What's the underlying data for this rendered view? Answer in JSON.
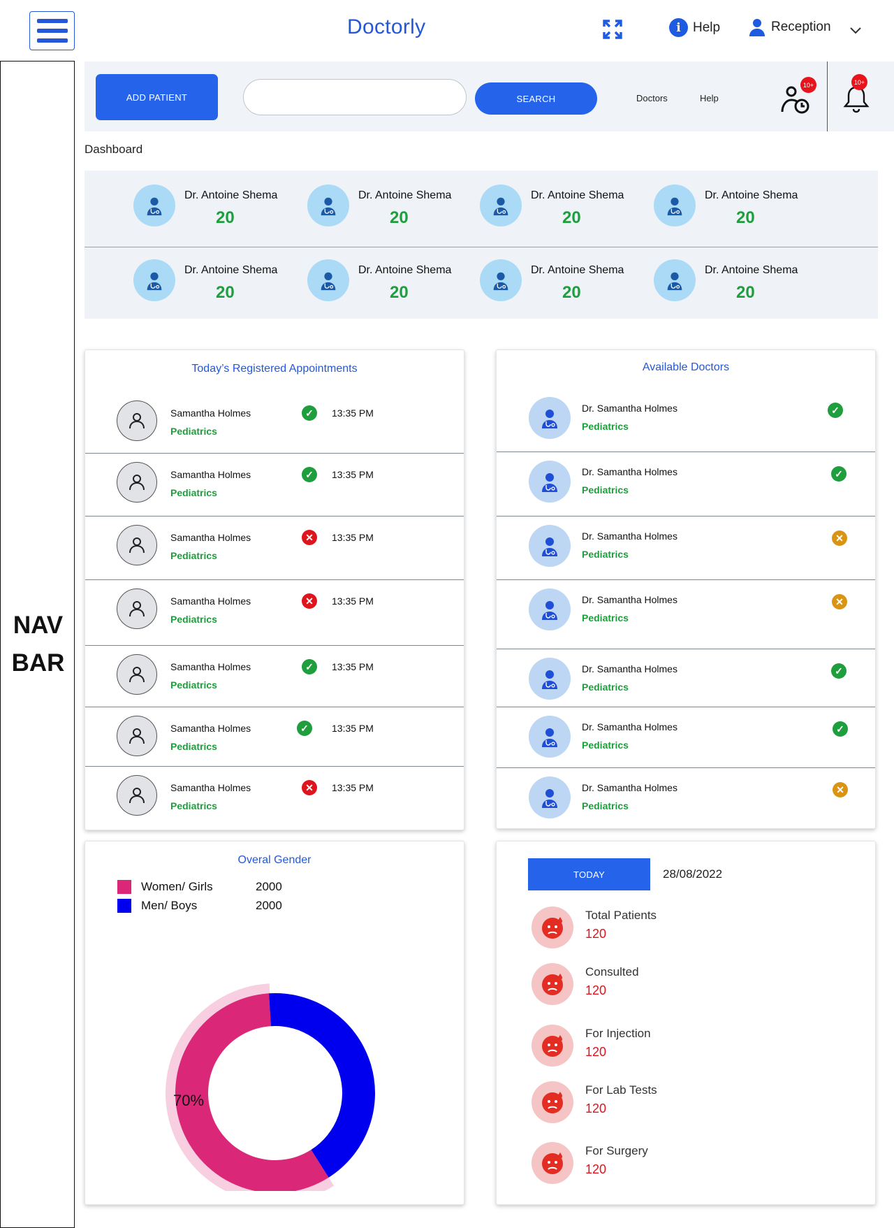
{
  "header": {
    "brand": "Doctorly",
    "help_label": "Help",
    "user_label": "Reception"
  },
  "navbar": {
    "label_line1": "NAV",
    "label_line2": "BAR"
  },
  "toolbar": {
    "add_patient_label": "ADD PATIENT",
    "search_placeholder": "",
    "search_button_label": "SEARCH",
    "links": [
      "Doctors",
      "Help"
    ],
    "appointments_badge": "10+",
    "notifications_badge": "10+"
  },
  "dashboard_title": "Dashboard",
  "doctor_stats": [
    {
      "name": "Dr. Antoine Shema",
      "count": "20"
    },
    {
      "name": "Dr. Antoine Shema",
      "count": "20"
    },
    {
      "name": "Dr. Antoine Shema",
      "count": "20"
    },
    {
      "name": "Dr. Antoine Shema",
      "count": "20"
    },
    {
      "name": "Dr. Antoine Shema",
      "count": "20"
    },
    {
      "name": "Dr. Antoine Shema",
      "count": "20"
    },
    {
      "name": "Dr. Antoine Shema",
      "count": "20"
    },
    {
      "name": "Dr. Antoine Shema",
      "count": "20"
    }
  ],
  "appointments": {
    "title": "Today’s Registered Appointments",
    "rows": [
      {
        "name": "Samantha Holmes",
        "dept": "Pediatrics",
        "status": "confirmed",
        "time": "13:35 PM"
      },
      {
        "name": "Samantha Holmes",
        "dept": "Pediatrics",
        "status": "confirmed",
        "time": "13:35 PM"
      },
      {
        "name": "Samantha Holmes",
        "dept": "Pediatrics",
        "status": "cancelled",
        "time": "13:35 PM"
      },
      {
        "name": "Samantha Holmes",
        "dept": "Pediatrics",
        "status": "cancelled",
        "time": "13:35 PM"
      },
      {
        "name": "Samantha Holmes",
        "dept": "Pediatrics",
        "status": "confirmed",
        "time": "13:35 PM"
      },
      {
        "name": "Samantha Holmes",
        "dept": "Pediatrics",
        "status": "confirmed",
        "time": "13:35 PM"
      },
      {
        "name": "Samantha Holmes",
        "dept": "Pediatrics",
        "status": "cancelled",
        "time": "13:35 PM"
      }
    ]
  },
  "available_doctors": {
    "title": "Available Doctors",
    "rows": [
      {
        "name": "Dr. Samantha Holmes",
        "dept": "Pediatrics",
        "status": "available"
      },
      {
        "name": "Dr. Samantha Holmes",
        "dept": "Pediatrics",
        "status": "available"
      },
      {
        "name": "Dr. Samantha Holmes",
        "dept": "Pediatrics",
        "status": "busy"
      },
      {
        "name": "Dr. Samantha Holmes",
        "dept": "Pediatrics",
        "status": "busy"
      },
      {
        "name": "Dr. Samantha Holmes",
        "dept": "Pediatrics",
        "status": "available"
      },
      {
        "name": "Dr. Samantha Holmes",
        "dept": "Pediatrics",
        "status": "available"
      },
      {
        "name": "Dr. Samantha Holmes",
        "dept": "Pediatrics",
        "status": "busy"
      }
    ]
  },
  "gender": {
    "title": "Overal Gender",
    "legend": [
      {
        "label": "Women/ Girls",
        "value": "2000",
        "color": "#db2777"
      },
      {
        "label": "Men/ Boys",
        "value": "2000",
        "color": "#0000ee"
      }
    ],
    "highlight_label": "70%"
  },
  "chart_data": {
    "type": "pie",
    "title": "Overal Gender",
    "series": [
      {
        "name": "Women/ Girls",
        "values": [
          2000
        ]
      },
      {
        "name": "Men/ Boys",
        "values": [
          2000
        ]
      }
    ],
    "slices": [
      {
        "label": "Women/ Girls",
        "fraction": 0.58,
        "color": "#db2777"
      },
      {
        "label": "Men/ Boys",
        "fraction": 0.42,
        "color": "#0000ee"
      }
    ],
    "annotation": "70%"
  },
  "daily_stats": {
    "today_label": "TODAY",
    "date": "28/08/2022",
    "items": [
      {
        "label": "Total Patients",
        "value": "120"
      },
      {
        "label": "Consulted",
        "value": "120"
      },
      {
        "label": "For Injection",
        "value": "120"
      },
      {
        "label": "For Lab Tests",
        "value": "120"
      },
      {
        "label": "For Surgery",
        "value": "120"
      }
    ]
  },
  "colors": {
    "accent": "#2563eb",
    "success": "#1e9e3c",
    "danger": "#e0141c",
    "warning": "#d99413"
  }
}
